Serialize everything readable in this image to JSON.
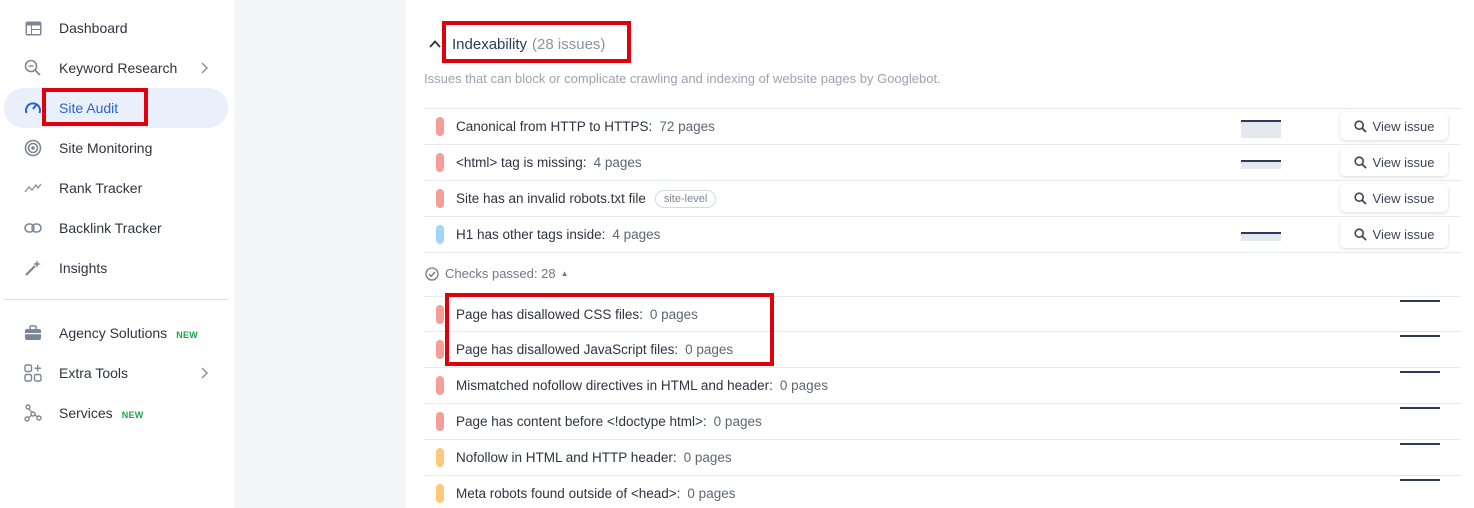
{
  "sidebar": {
    "items": [
      {
        "label": "Dashboard",
        "icon": "table-icon"
      },
      {
        "label": "Keyword Research",
        "icon": "keyword-search-icon"
      },
      {
        "label": "Site Audit",
        "icon": "speedometer-icon",
        "active": true
      },
      {
        "label": "Site Monitoring",
        "icon": "radar-icon"
      },
      {
        "label": "Rank Tracker",
        "icon": "trend-line-icon"
      },
      {
        "label": "Backlink Tracker",
        "icon": "link-icon"
      },
      {
        "label": "Insights",
        "icon": "magic-wand-icon"
      },
      {
        "label": "Agency Solutions",
        "icon": "briefcase-icon",
        "badge": "NEW"
      },
      {
        "label": "Extra Tools",
        "icon": "grid-plus-icon"
      },
      {
        "label": "Services",
        "icon": "nodes-icon",
        "badge": "NEW"
      }
    ]
  },
  "section": {
    "title": "Indexability",
    "count": "(28 issues)",
    "subtitle": "Issues that can block or complicate crawling and indexing of website pages by Googlebot."
  },
  "issues": [
    {
      "label": "Canonical from HTTP to HTTPS:",
      "pages": "72 pages",
      "severity_color": "#f59e98",
      "button": "View issue"
    },
    {
      "label": "<html> tag is missing:",
      "pages": "4 pages",
      "severity_color": "#f59e98",
      "button": "View issue"
    },
    {
      "label": "Site has an invalid robots.txt file",
      "pill": "site-level",
      "severity_color": "#f59e98",
      "button": "View issue"
    },
    {
      "label": "H1 has other tags inside:",
      "pages": "4 pages",
      "severity_color": "#9fd6f8",
      "button": "View issue"
    }
  ],
  "checks_passed": {
    "label": "Checks passed: 28"
  },
  "passed_checks": [
    {
      "label": "Page has disallowed CSS files:",
      "pages": "0 pages",
      "severity_color": "#f59e98"
    },
    {
      "label": "Page has disallowed JavaScript files:",
      "pages": "0 pages",
      "severity_color": "#f59e98"
    },
    {
      "label": "Mismatched nofollow directives in HTML and header:",
      "pages": "0 pages",
      "severity_color": "#f59e98"
    },
    {
      "label": "Page has content before <!doctype html>:",
      "pages": "0 pages",
      "severity_color": "#f59e98"
    },
    {
      "label": "Nofollow in HTML and HTTP header:",
      "pages": "0 pages",
      "severity_color": "#fcc97a"
    },
    {
      "label": "Meta robots found outside of <head>:",
      "pages": "0 pages",
      "severity_color": "#fcc97a"
    }
  ]
}
